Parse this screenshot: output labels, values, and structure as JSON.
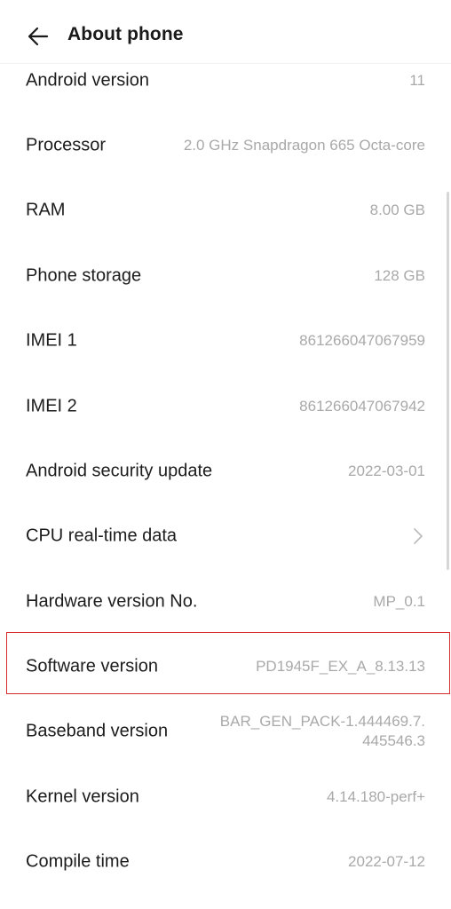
{
  "header": {
    "back_icon": "arrow-left-icon",
    "title": "About phone"
  },
  "items": [
    {
      "label": "Android version",
      "value": "11"
    },
    {
      "label": "Processor",
      "value": "2.0 GHz Snapdragon 665 Octa-core"
    },
    {
      "label": "RAM",
      "value": "8.00 GB"
    },
    {
      "label": "Phone storage",
      "value": "128 GB"
    },
    {
      "label": "IMEI 1",
      "value": "861266047067959"
    },
    {
      "label": "IMEI 2",
      "value": "861266047067942"
    },
    {
      "label": "Android security update",
      "value": "2022-03-01"
    },
    {
      "label": "CPU real-time data",
      "icon": "chevron-right-icon"
    },
    {
      "label": "Hardware version No.",
      "value": "MP_0.1"
    },
    {
      "label": "Software version",
      "value": "PD1945F_EX_A_8.13.13",
      "highlighted": true,
      "highlight_color": "#d62b2b"
    },
    {
      "label": "Baseband version",
      "value": "BAR_GEN_PACK-1.444469.7. 445546.3"
    },
    {
      "label": "Kernel version",
      "value": "4.14.180-perf+"
    },
    {
      "label": "Compile time",
      "value": "2022-07-12"
    }
  ]
}
